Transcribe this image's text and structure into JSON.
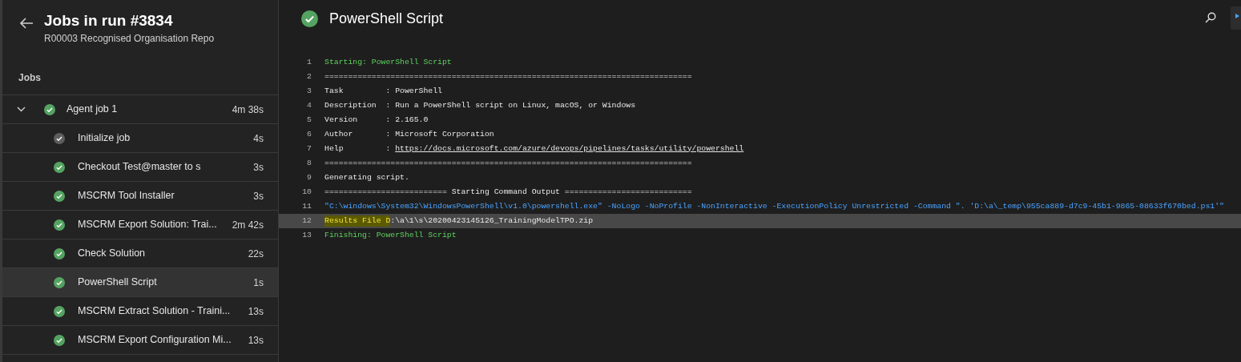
{
  "sidebar": {
    "title": "Jobs in run #3834",
    "subtitle": "R00003 Recognised Organisation Repo",
    "section": "Jobs",
    "jobs": [
      {
        "name": "Agent job 1",
        "duration": "4m 38s",
        "muted": false,
        "expanded": true,
        "selected": false,
        "children": [
          {
            "name": "Initialize job",
            "duration": "4s",
            "muted": true,
            "selected": false
          },
          {
            "name": "Checkout Test@master to s",
            "duration": "3s",
            "muted": false,
            "selected": false
          },
          {
            "name": "MSCRM Tool Installer",
            "duration": "3s",
            "muted": false,
            "selected": false
          },
          {
            "name": "MSCRM Export Solution: Trai...",
            "duration": "2m 42s",
            "muted": false,
            "selected": false
          },
          {
            "name": "Check Solution",
            "duration": "22s",
            "muted": false,
            "selected": false
          },
          {
            "name": "PowerShell Script",
            "duration": "1s",
            "muted": false,
            "selected": true
          },
          {
            "name": "MSCRM Extract Solution - Traini...",
            "duration": "13s",
            "muted": false,
            "selected": false
          },
          {
            "name": "MSCRM Export Configuration Mi...",
            "duration": "13s",
            "muted": false,
            "selected": false
          }
        ]
      }
    ]
  },
  "log": {
    "title": "PowerShell Script",
    "lines": [
      {
        "number": "1",
        "kind": "section",
        "selected": false,
        "segments": [
          {
            "kind": "text",
            "text": "Starting: PowerShell Script"
          }
        ]
      },
      {
        "number": "2",
        "kind": "plain",
        "selected": false,
        "segments": [
          {
            "kind": "text",
            "text": "=============================================================================="
          }
        ]
      },
      {
        "number": "3",
        "kind": "plain",
        "selected": false,
        "segments": [
          {
            "kind": "text",
            "text": "Task         : PowerShell"
          }
        ]
      },
      {
        "number": "4",
        "kind": "plain",
        "selected": false,
        "segments": [
          {
            "kind": "text",
            "text": "Description  : Run a PowerShell script on Linux, macOS, or Windows"
          }
        ]
      },
      {
        "number": "5",
        "kind": "plain",
        "selected": false,
        "segments": [
          {
            "kind": "text",
            "text": "Version      : 2.165.0"
          }
        ]
      },
      {
        "number": "6",
        "kind": "plain",
        "selected": false,
        "segments": [
          {
            "kind": "text",
            "text": "Author       : Microsoft Corporation"
          }
        ]
      },
      {
        "number": "7",
        "kind": "plain",
        "selected": false,
        "segments": [
          {
            "kind": "text",
            "text": "Help         : "
          },
          {
            "kind": "link",
            "text": "https://docs.microsoft.com/azure/devops/pipelines/tasks/utility/powershell"
          }
        ]
      },
      {
        "number": "8",
        "kind": "plain",
        "selected": false,
        "segments": [
          {
            "kind": "text",
            "text": "=============================================================================="
          }
        ]
      },
      {
        "number": "9",
        "kind": "plain",
        "selected": false,
        "segments": [
          {
            "kind": "text",
            "text": "Generating script."
          }
        ]
      },
      {
        "number": "10",
        "kind": "plain",
        "selected": false,
        "segments": [
          {
            "kind": "text",
            "text": "========================== Starting Command Output ==========================="
          }
        ]
      },
      {
        "number": "11",
        "kind": "command",
        "selected": false,
        "segments": [
          {
            "kind": "text",
            "text": "\"C:\\windows\\System32\\WindowsPowerShell\\v1.0\\powershell.exe\" -NoLogo -NoProfile -NonInteractive -ExecutionPolicy Unrestricted -Command \". 'D:\\a\\_temp\\955ca889-d7c9-45b1-9865-08633f670bed.ps1'\""
          }
        ]
      },
      {
        "number": "12",
        "kind": "plain",
        "selected": true,
        "segments": [
          {
            "kind": "match",
            "text": "Results File D"
          },
          {
            "kind": "text",
            "text": ":\\a\\1\\s\\20200423145126_TrainingModelTPO.zip"
          }
        ]
      },
      {
        "number": "13",
        "kind": "section",
        "selected": false,
        "segments": [
          {
            "kind": "text",
            "text": "Finishing: PowerShell Script"
          }
        ]
      }
    ]
  }
}
